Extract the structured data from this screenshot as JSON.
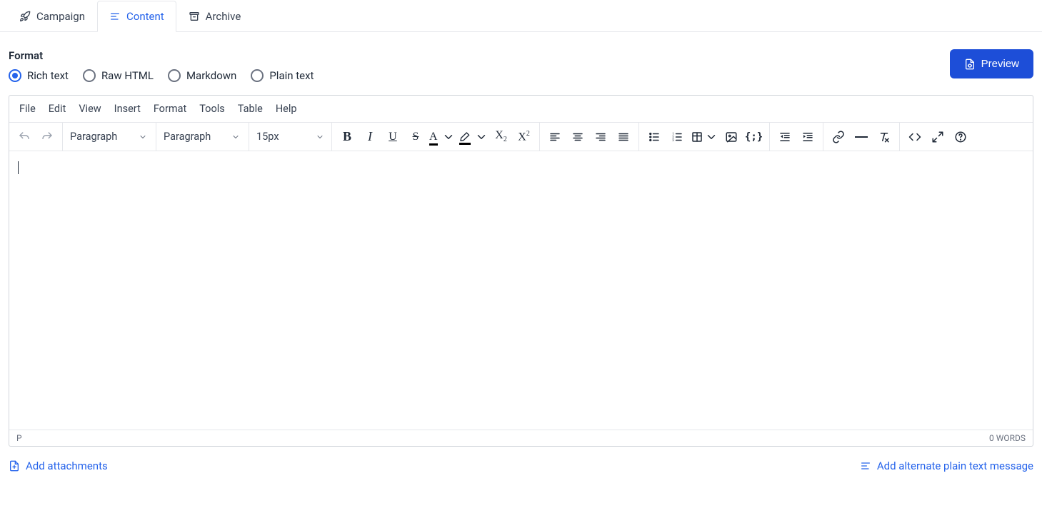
{
  "tabs": {
    "campaign": "Campaign",
    "content": "Content",
    "archive": "Archive"
  },
  "format": {
    "label": "Format",
    "options": {
      "rich_text": "Rich text",
      "raw_html": "Raw HTML",
      "markdown": "Markdown",
      "plain_text": "Plain text"
    },
    "selected": "rich_text"
  },
  "preview_button": "Preview",
  "editor": {
    "menu": {
      "file": "File",
      "edit": "Edit",
      "view": "View",
      "insert": "Insert",
      "format": "Format",
      "tools": "Tools",
      "table": "Table",
      "help": "Help"
    },
    "toolbar": {
      "block_format": "Paragraph",
      "style_format": "Paragraph",
      "font_size": "15px"
    },
    "status": {
      "path": "P",
      "word_count": "0 WORDS"
    }
  },
  "bottom": {
    "add_attachments": "Add attachments",
    "add_alt_text": "Add alternate plain text message"
  }
}
